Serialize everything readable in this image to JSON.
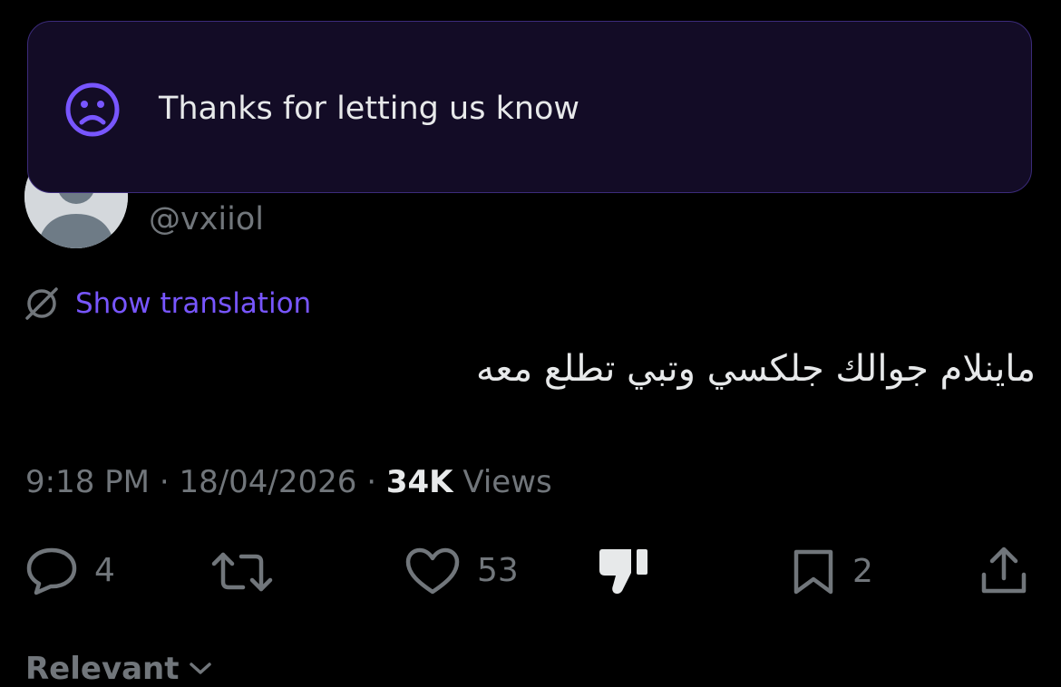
{
  "toast": {
    "message": "Thanks for letting us know",
    "icon": "sad-face-icon",
    "accent_color": "#7856ff"
  },
  "author": {
    "handle": "@vxiiol"
  },
  "translation": {
    "link_label": "Show translation",
    "icon": "translate-icon"
  },
  "tweet": {
    "text": "ماينلام جوالك جلكسي وتبي تطلع معه"
  },
  "meta": {
    "time": "9:18 PM",
    "separator": "·",
    "date": "18/04/2026",
    "views_count": "34K",
    "views_label": "Views"
  },
  "actions": {
    "reply_count": "4",
    "retweet_count": "",
    "like_count": "53",
    "bookmark_count": "2"
  },
  "sort": {
    "label": "Relevant"
  },
  "colors": {
    "background": "#000000",
    "text": "#e7e9ea",
    "muted": "#71767b",
    "link": "#7856ff"
  }
}
